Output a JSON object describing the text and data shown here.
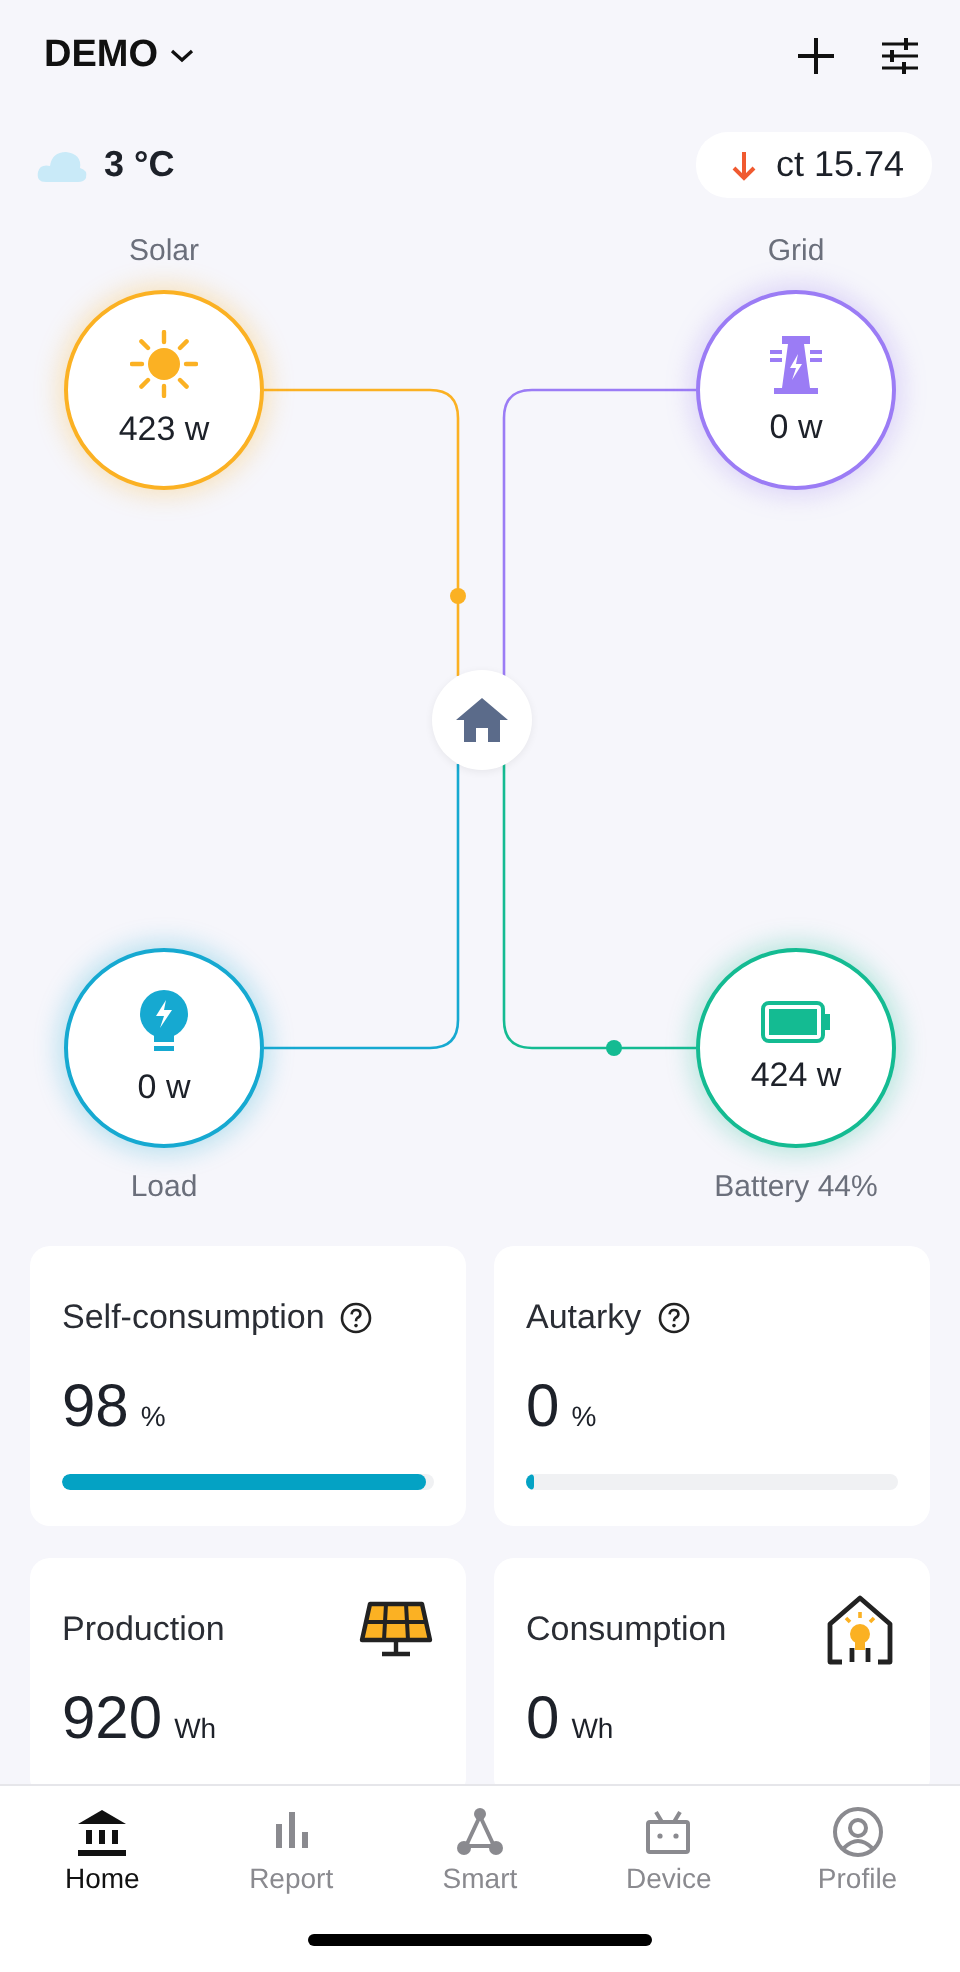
{
  "header": {
    "title": "DEMO"
  },
  "weather": {
    "temperature": "3 °C"
  },
  "price": {
    "falling": true,
    "value": "ct 15.74"
  },
  "flow": {
    "nodes": [
      {
        "kind": "solar",
        "label": "Solar",
        "value": "423 w",
        "color": "#fbb123",
        "flowing": true
      },
      {
        "kind": "grid",
        "label": "Grid",
        "value": "0 w",
        "color": "#9b7cf5",
        "flowing": false
      },
      {
        "kind": "load",
        "label": "Load",
        "value": "0 w",
        "color": "#16a9d1",
        "flowing": false
      },
      {
        "kind": "battery",
        "label": "Battery 44%",
        "value": "424 w",
        "color": "#14bb92",
        "flowing": true
      }
    ]
  },
  "ratios": [
    {
      "title": "Self-consumption",
      "value": "98",
      "unit": "%",
      "level": 0.98
    },
    {
      "title": "Autarky",
      "value": "0",
      "unit": "%",
      "level": 0
    }
  ],
  "energy": [
    {
      "kind": "production",
      "title": "Production",
      "value": "920",
      "unit": "Wh"
    },
    {
      "kind": "consumption",
      "title": "Consumption",
      "value": "0",
      "unit": "Wh"
    }
  ],
  "tabs": [
    {
      "kind": "home",
      "label": "Home",
      "selected": true
    },
    {
      "kind": "report",
      "label": "Report",
      "selected": false
    },
    {
      "kind": "smart",
      "label": "Smart",
      "selected": false
    },
    {
      "kind": "device",
      "label": "Device",
      "selected": false
    },
    {
      "kind": "profile",
      "label": "Profile",
      "selected": false
    }
  ]
}
